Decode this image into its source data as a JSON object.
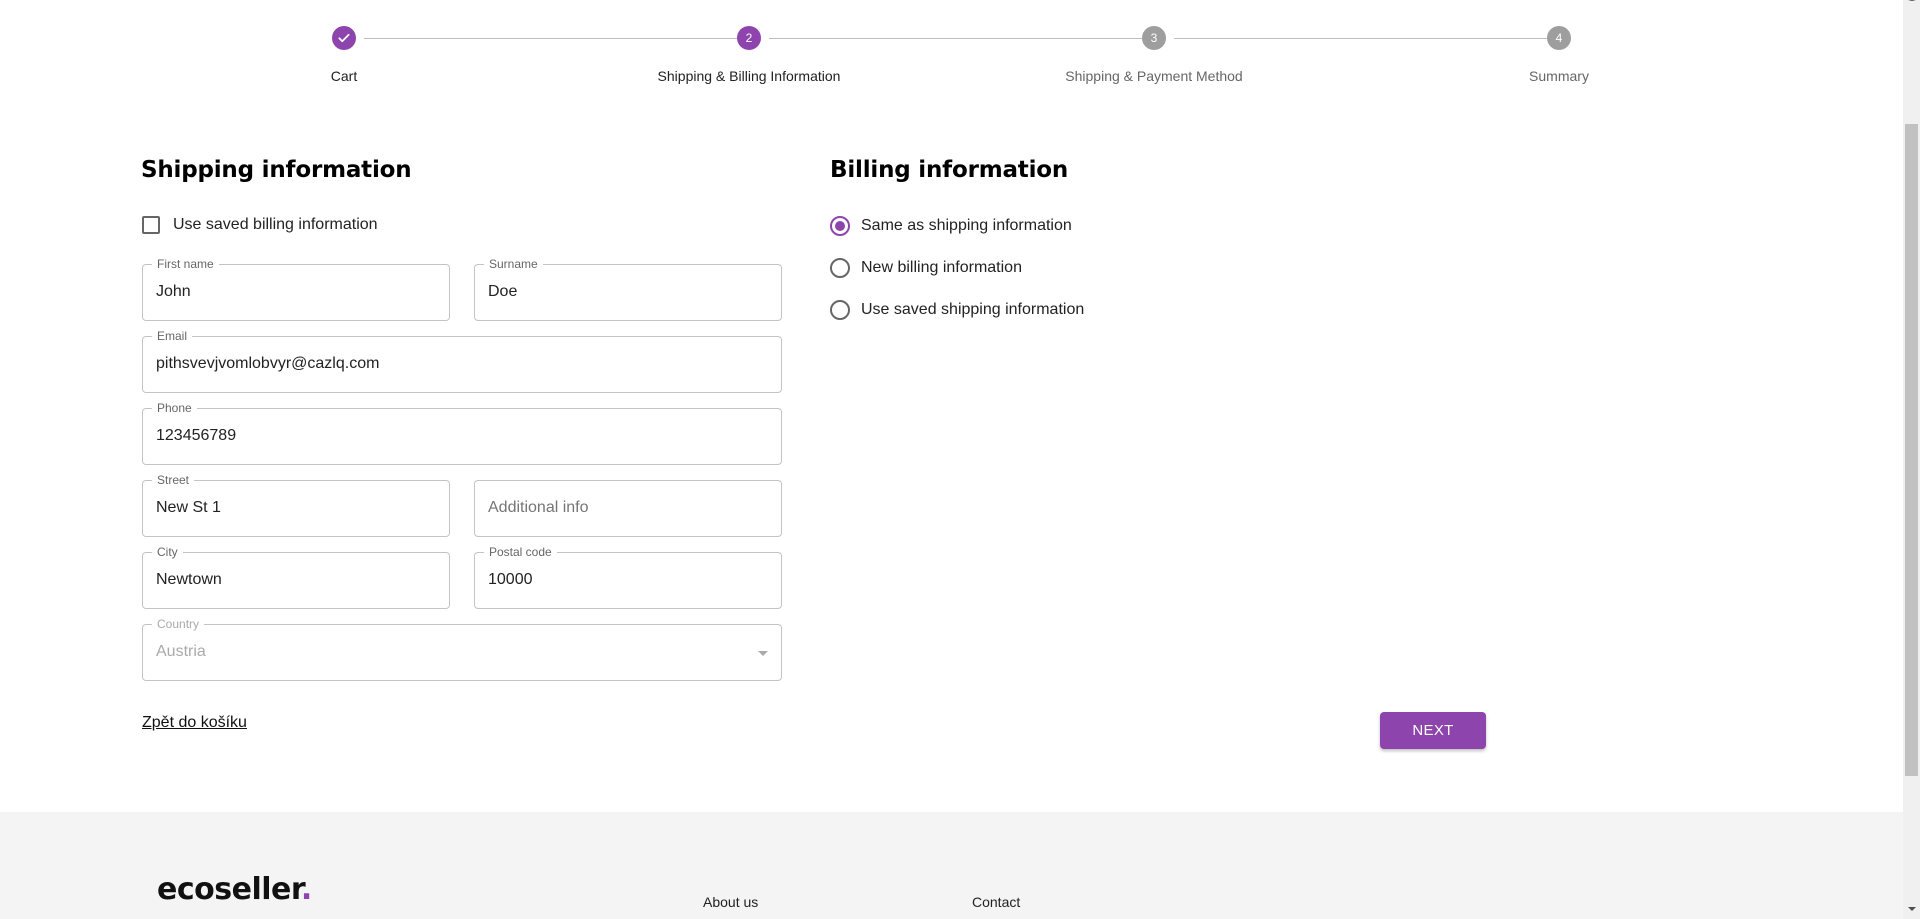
{
  "stepper": {
    "steps": [
      {
        "number": "1",
        "label": "Cart",
        "state": "completed",
        "icon": "check-icon"
      },
      {
        "number": "2",
        "label": "Shipping & Billing Information",
        "state": "active"
      },
      {
        "number": "3",
        "label": "Shipping & Payment Method",
        "state": "pending"
      },
      {
        "number": "4",
        "label": "Summary",
        "state": "pending"
      }
    ]
  },
  "shipping": {
    "title": "Shipping information",
    "use_saved_checkbox": {
      "label": "Use saved billing information",
      "checked": false
    },
    "fields": {
      "first_name": {
        "label": "First name",
        "value": "John"
      },
      "surname": {
        "label": "Surname",
        "value": "Doe"
      },
      "email": {
        "label": "Email",
        "value": "pithsvevjvomlobvyr@cazlq.com"
      },
      "phone": {
        "label": "Phone",
        "value": "123456789"
      },
      "street": {
        "label": "Street",
        "value": "New St 1"
      },
      "additional_info": {
        "placeholder": "Additional info",
        "value": ""
      },
      "city": {
        "label": "City",
        "value": "Newtown"
      },
      "postal_code": {
        "label": "Postal code",
        "value": "10000"
      },
      "country": {
        "label": "Country",
        "value": "Austria",
        "disabled": true
      }
    },
    "back_link": "Zpět do košíku"
  },
  "billing": {
    "title": "Billing information",
    "options": [
      {
        "label": "Same as shipping information",
        "checked": true
      },
      {
        "label": "New billing information",
        "checked": false
      },
      {
        "label": "Use saved shipping information",
        "checked": false
      }
    ]
  },
  "actions": {
    "next_label": "NEXT"
  },
  "footer": {
    "logo_text": "ecoseller",
    "logo_dot": ".",
    "links": [
      "About us",
      "Contact"
    ]
  },
  "colors": {
    "accent": "#8e44ad",
    "pending_step": "#9e9e9e",
    "footer_bg": "#f4f4f4"
  }
}
